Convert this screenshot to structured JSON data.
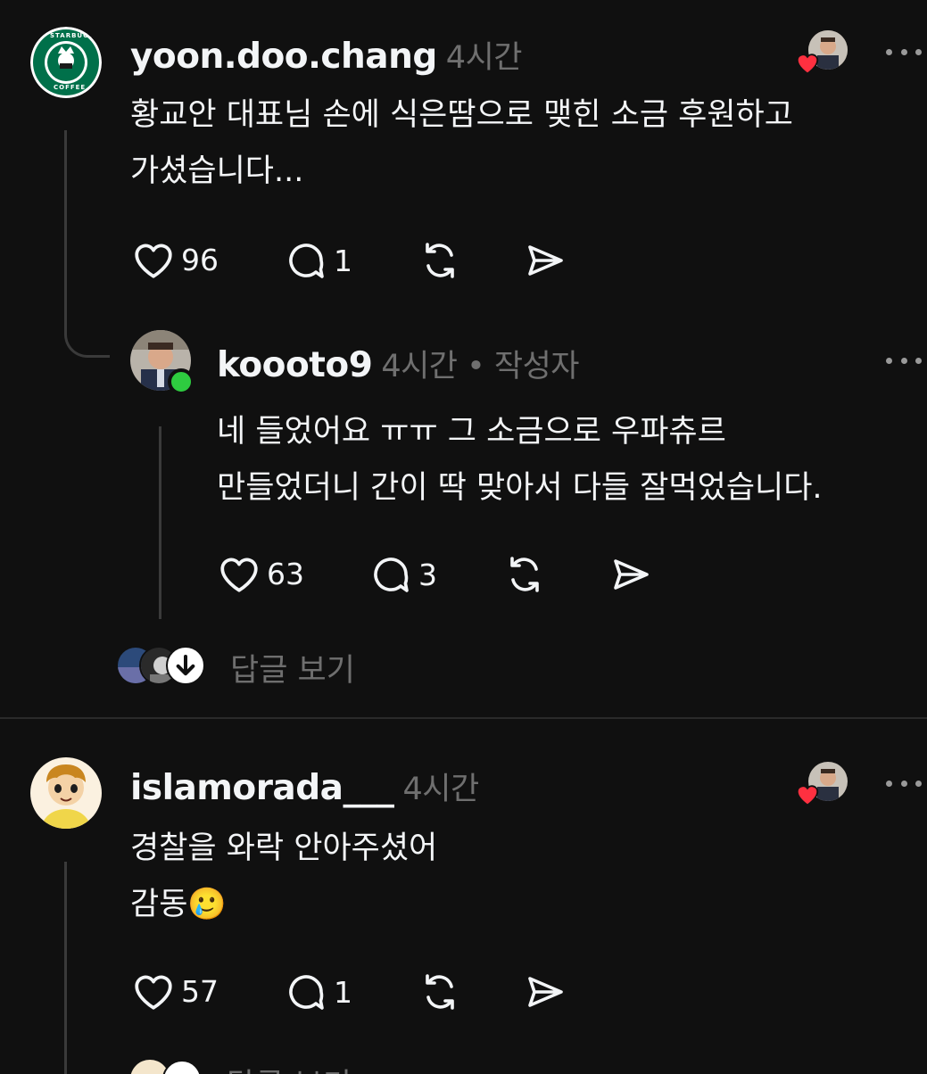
{
  "posts": [
    {
      "username": "yoon.doo.chang",
      "time": "4시간",
      "text_lines": [
        "황교안 대표님 손에 식은땀으로 맺힌 소금 후원하고",
        "가셨습니다..."
      ],
      "likes": "96",
      "replies": "1"
    },
    {
      "username": "koooto9",
      "time": "4시간 • 작성자",
      "text_lines": [
        "네 들었어요 ㅠㅠ 그 소금으로 우파츄르",
        "만들었더니 간이 딱 맞아서 다들 잘먹었습니다."
      ],
      "likes": "63",
      "replies": "3"
    },
    {
      "username": "islamorada___",
      "time": "4시간",
      "text_lines": [
        "경찰을  와락  안아주셨어",
        "감동🥲"
      ],
      "likes": "57",
      "replies": "1"
    }
  ],
  "view_replies_label": "답글 보기",
  "avatar_logo_text": {
    "top": "STARBUGS",
    "bottom": "COFFEE"
  },
  "icons": [
    "heart-icon",
    "comment-icon",
    "repost-icon",
    "share-icon",
    "more-icon",
    "arrow-down-icon"
  ],
  "colors": {
    "background": "#101010",
    "text": "#f3f5f7",
    "secondary": "#6f6f6f",
    "like_red": "#ff3040",
    "online_green": "#2ecc40",
    "starbucks_green": "#00704a"
  }
}
